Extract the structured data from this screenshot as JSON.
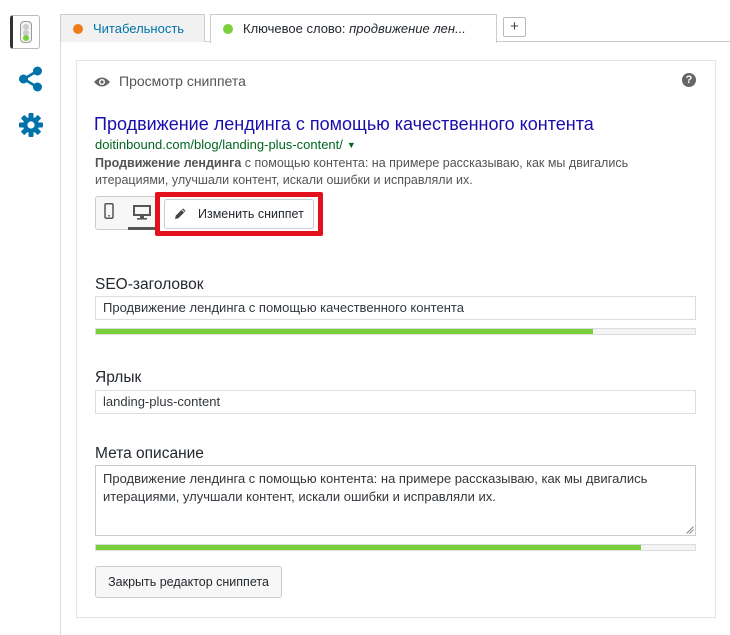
{
  "tabs": [
    {
      "label": "Читабельность",
      "dot_color": "#ee7c1b"
    },
    {
      "label": "Ключевое слово: ",
      "label_italic": "продвижение лен...",
      "dot_color": "#7ad03a"
    }
  ],
  "add_tab_label": "+",
  "preview": {
    "section_title": "Просмотр сниппета",
    "help_label": "?",
    "title": "Продвижение лендинга с помощью качественного контента",
    "url": "doitinbound.com/blog/landing-plus-content/",
    "url_caret": "▼",
    "desc_bold": "Продвижение лендинга",
    "desc_rest": " с помощью контента: на примере рассказываю, как мы двигались итерациями, улучшали контент, искали ошибки и исправляли их.",
    "edit_button": "Изменить сниппет"
  },
  "fields": {
    "seo_title_label": "SEO-заголовок",
    "seo_title_value": "Продвижение лендинга с помощью качественного контента",
    "seo_title_progress": 0.83,
    "slug_label": "Ярлык",
    "slug_value": "landing-plus-content",
    "meta_label": "Мета описание",
    "meta_value": "Продвижение лендинга с помощью контента: на примере рассказываю, как мы двигались итерациями, улучшали контент, искали ошибки и исправляли их.",
    "meta_progress": 0.91,
    "close_button": "Закрыть редактор сниппета"
  },
  "colors": {
    "readability_dot": "#ee7c1b",
    "keyword_dot": "#7ad03a",
    "progress_good": "#7ad03a",
    "highlight_border": "#e3111b",
    "link_title": "#1a0dab",
    "url_green": "#006621",
    "sidebar_icon": "#0073aa"
  },
  "icons": [
    "traffic-light-icon",
    "share-icon",
    "gear-icon",
    "eye-icon",
    "help-icon",
    "mobile-icon",
    "desktop-icon",
    "pencil-icon"
  ]
}
